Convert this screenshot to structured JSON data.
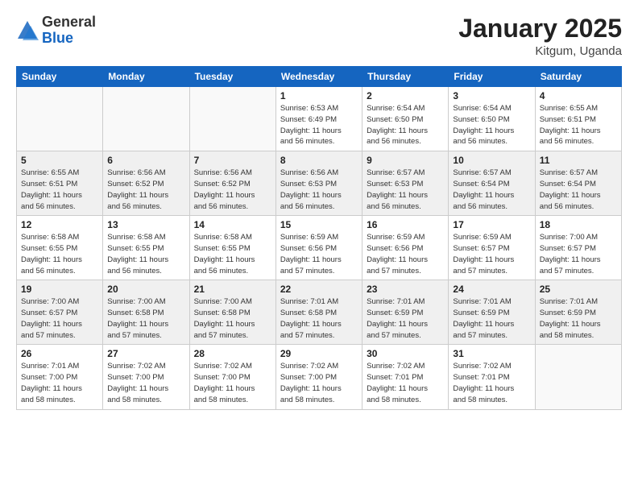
{
  "header": {
    "logo_general": "General",
    "logo_blue": "Blue",
    "title": "January 2025",
    "subtitle": "Kitgum, Uganda"
  },
  "weekdays": [
    "Sunday",
    "Monday",
    "Tuesday",
    "Wednesday",
    "Thursday",
    "Friday",
    "Saturday"
  ],
  "weeks": [
    {
      "shaded": false,
      "days": [
        {
          "num": "",
          "info": ""
        },
        {
          "num": "",
          "info": ""
        },
        {
          "num": "",
          "info": ""
        },
        {
          "num": "1",
          "info": "Sunrise: 6:53 AM\nSunset: 6:49 PM\nDaylight: 11 hours\nand 56 minutes."
        },
        {
          "num": "2",
          "info": "Sunrise: 6:54 AM\nSunset: 6:50 PM\nDaylight: 11 hours\nand 56 minutes."
        },
        {
          "num": "3",
          "info": "Sunrise: 6:54 AM\nSunset: 6:50 PM\nDaylight: 11 hours\nand 56 minutes."
        },
        {
          "num": "4",
          "info": "Sunrise: 6:55 AM\nSunset: 6:51 PM\nDaylight: 11 hours\nand 56 minutes."
        }
      ]
    },
    {
      "shaded": true,
      "days": [
        {
          "num": "5",
          "info": "Sunrise: 6:55 AM\nSunset: 6:51 PM\nDaylight: 11 hours\nand 56 minutes."
        },
        {
          "num": "6",
          "info": "Sunrise: 6:56 AM\nSunset: 6:52 PM\nDaylight: 11 hours\nand 56 minutes."
        },
        {
          "num": "7",
          "info": "Sunrise: 6:56 AM\nSunset: 6:52 PM\nDaylight: 11 hours\nand 56 minutes."
        },
        {
          "num": "8",
          "info": "Sunrise: 6:56 AM\nSunset: 6:53 PM\nDaylight: 11 hours\nand 56 minutes."
        },
        {
          "num": "9",
          "info": "Sunrise: 6:57 AM\nSunset: 6:53 PM\nDaylight: 11 hours\nand 56 minutes."
        },
        {
          "num": "10",
          "info": "Sunrise: 6:57 AM\nSunset: 6:54 PM\nDaylight: 11 hours\nand 56 minutes."
        },
        {
          "num": "11",
          "info": "Sunrise: 6:57 AM\nSunset: 6:54 PM\nDaylight: 11 hours\nand 56 minutes."
        }
      ]
    },
    {
      "shaded": false,
      "days": [
        {
          "num": "12",
          "info": "Sunrise: 6:58 AM\nSunset: 6:55 PM\nDaylight: 11 hours\nand 56 minutes."
        },
        {
          "num": "13",
          "info": "Sunrise: 6:58 AM\nSunset: 6:55 PM\nDaylight: 11 hours\nand 56 minutes."
        },
        {
          "num": "14",
          "info": "Sunrise: 6:58 AM\nSunset: 6:55 PM\nDaylight: 11 hours\nand 56 minutes."
        },
        {
          "num": "15",
          "info": "Sunrise: 6:59 AM\nSunset: 6:56 PM\nDaylight: 11 hours\nand 57 minutes."
        },
        {
          "num": "16",
          "info": "Sunrise: 6:59 AM\nSunset: 6:56 PM\nDaylight: 11 hours\nand 57 minutes."
        },
        {
          "num": "17",
          "info": "Sunrise: 6:59 AM\nSunset: 6:57 PM\nDaylight: 11 hours\nand 57 minutes."
        },
        {
          "num": "18",
          "info": "Sunrise: 7:00 AM\nSunset: 6:57 PM\nDaylight: 11 hours\nand 57 minutes."
        }
      ]
    },
    {
      "shaded": true,
      "days": [
        {
          "num": "19",
          "info": "Sunrise: 7:00 AM\nSunset: 6:57 PM\nDaylight: 11 hours\nand 57 minutes."
        },
        {
          "num": "20",
          "info": "Sunrise: 7:00 AM\nSunset: 6:58 PM\nDaylight: 11 hours\nand 57 minutes."
        },
        {
          "num": "21",
          "info": "Sunrise: 7:00 AM\nSunset: 6:58 PM\nDaylight: 11 hours\nand 57 minutes."
        },
        {
          "num": "22",
          "info": "Sunrise: 7:01 AM\nSunset: 6:58 PM\nDaylight: 11 hours\nand 57 minutes."
        },
        {
          "num": "23",
          "info": "Sunrise: 7:01 AM\nSunset: 6:59 PM\nDaylight: 11 hours\nand 57 minutes."
        },
        {
          "num": "24",
          "info": "Sunrise: 7:01 AM\nSunset: 6:59 PM\nDaylight: 11 hours\nand 57 minutes."
        },
        {
          "num": "25",
          "info": "Sunrise: 7:01 AM\nSunset: 6:59 PM\nDaylight: 11 hours\nand 58 minutes."
        }
      ]
    },
    {
      "shaded": false,
      "days": [
        {
          "num": "26",
          "info": "Sunrise: 7:01 AM\nSunset: 7:00 PM\nDaylight: 11 hours\nand 58 minutes."
        },
        {
          "num": "27",
          "info": "Sunrise: 7:02 AM\nSunset: 7:00 PM\nDaylight: 11 hours\nand 58 minutes."
        },
        {
          "num": "28",
          "info": "Sunrise: 7:02 AM\nSunset: 7:00 PM\nDaylight: 11 hours\nand 58 minutes."
        },
        {
          "num": "29",
          "info": "Sunrise: 7:02 AM\nSunset: 7:00 PM\nDaylight: 11 hours\nand 58 minutes."
        },
        {
          "num": "30",
          "info": "Sunrise: 7:02 AM\nSunset: 7:01 PM\nDaylight: 11 hours\nand 58 minutes."
        },
        {
          "num": "31",
          "info": "Sunrise: 7:02 AM\nSunset: 7:01 PM\nDaylight: 11 hours\nand 58 minutes."
        },
        {
          "num": "",
          "info": ""
        }
      ]
    }
  ]
}
